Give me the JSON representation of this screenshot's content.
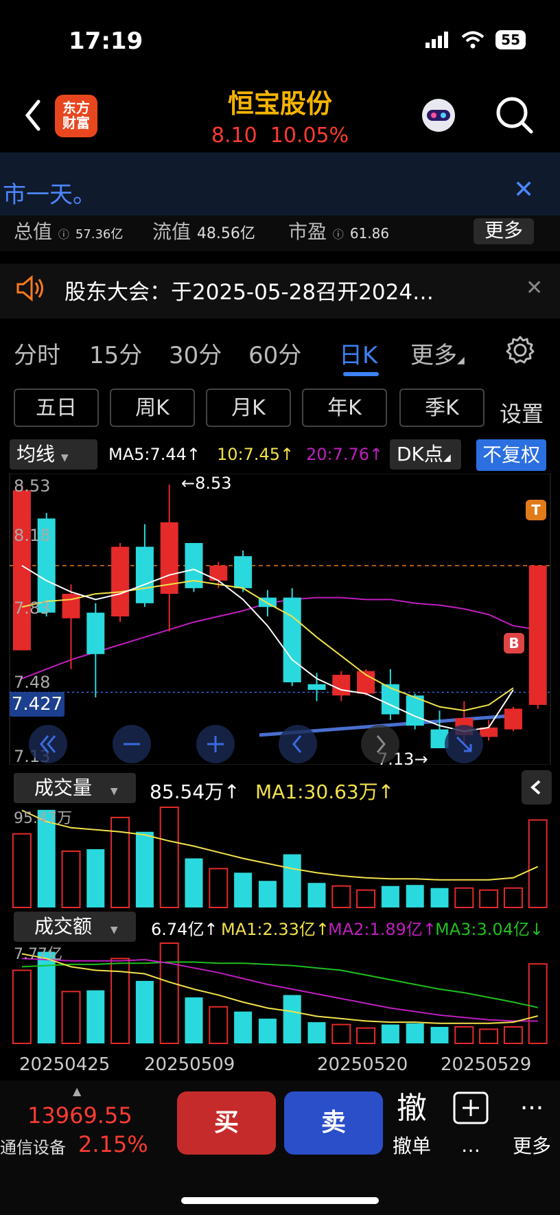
{
  "status": {
    "time": "17:19",
    "battery": "55"
  },
  "header": {
    "logo_line1": "东方",
    "logo_line2": "财富",
    "stock_name": "恒宝股份",
    "price": "8.10",
    "change_pct": "10.05%"
  },
  "banner": {
    "text": "市一天。"
  },
  "stats": {
    "total_label": "总值",
    "total_value": "57.36亿",
    "float_label": "流值",
    "float_value": "48.56亿",
    "pe_label": "市盈",
    "pe_value": "61.86",
    "more": "更多"
  },
  "notice": {
    "text": "股东大会：于2025-05-28召开2024…"
  },
  "period_tabs": [
    "分时",
    "15分",
    "30分",
    "60分",
    "日K",
    "更多"
  ],
  "k_buttons": [
    "五日",
    "周K",
    "月K",
    "年K",
    "季K"
  ],
  "settings_label": "设置",
  "ma_bar": {
    "selector": "均线",
    "ma5": "MA5:7.44↑",
    "ma10": "10:7.45↑",
    "ma20": "20:7.76↑",
    "dk": "DK点",
    "fq": "不复权"
  },
  "price_axis": {
    "labels": [
      "8.53",
      "8.18",
      "7.83",
      "7.48",
      "7.13"
    ],
    "current": "7.427",
    "high_marker": "←8.53",
    "low_marker": "7.13→"
  },
  "markers": {
    "t": "T",
    "b": "B"
  },
  "volume": {
    "selector": "成交量",
    "value": "85.54万↑",
    "ma1": "MA1:30.63万↑",
    "max_label": "95.47万"
  },
  "amount": {
    "selector": "成交额",
    "value": "6.74亿↑",
    "ma1": "MA1:2.33亿↑",
    "ma2": "MA2:1.89亿↑",
    "ma3": "MA3:3.04亿↓",
    "max_label": "7.77亿"
  },
  "dates": [
    "20250425",
    "20250509",
    "20250520",
    "20250529"
  ],
  "bottom": {
    "index_value": "13969.55",
    "index_name": "通信设备",
    "index_pct": "2.15%",
    "buy": "买",
    "sell": "卖",
    "cancel_glyph": "撤",
    "cancel_label": "撤单",
    "add_label": "…",
    "more_label": "更多"
  },
  "colors": {
    "up": "#e52a2a",
    "down": "#2ad9dd",
    "ma5": "#ffffff",
    "ma10": "#f2e24a",
    "ma20": "#c01ec0",
    "accent": "#3b82f6",
    "ma3": "#1ec01e"
  },
  "chart_data": {
    "type": "candlestick",
    "ylim": [
      7.13,
      8.53
    ],
    "candles": [
      {
        "open": 7.65,
        "close": 8.5,
        "high": 8.53,
        "low": 7.65
      },
      {
        "open": 8.35,
        "close": 7.85,
        "high": 8.38,
        "low": 7.83
      },
      {
        "open": 7.82,
        "close": 7.95,
        "high": 8.0,
        "low": 7.55
      },
      {
        "open": 7.85,
        "close": 7.63,
        "high": 7.9,
        "low": 7.4
      },
      {
        "open": 7.83,
        "close": 8.2,
        "high": 8.22,
        "low": 7.8
      },
      {
        "open": 8.2,
        "close": 7.9,
        "high": 8.32,
        "low": 7.88
      },
      {
        "open": 7.95,
        "close": 8.33,
        "high": 8.53,
        "low": 7.75
      },
      {
        "open": 8.22,
        "close": 7.98,
        "high": 8.22,
        "low": 7.96
      },
      {
        "open": 8.02,
        "close": 8.1,
        "high": 8.12,
        "low": 7.98
      },
      {
        "open": 8.15,
        "close": 7.98,
        "high": 8.18,
        "low": 7.96
      },
      {
        "open": 7.93,
        "close": 7.88,
        "high": 7.97,
        "low": 7.83
      },
      {
        "open": 7.93,
        "close": 7.48,
        "high": 7.98,
        "low": 7.46
      },
      {
        "open": 7.47,
        "close": 7.44,
        "high": 7.53,
        "low": 7.38
      },
      {
        "open": 7.41,
        "close": 7.52,
        "high": 7.54,
        "low": 7.38
      },
      {
        "open": 7.42,
        "close": 7.54,
        "high": 7.55,
        "low": 7.41
      },
      {
        "open": 7.47,
        "close": 7.31,
        "high": 7.55,
        "low": 7.28
      },
      {
        "open": 7.41,
        "close": 7.25,
        "high": 7.42,
        "low": 7.23
      },
      {
        "open": 7.23,
        "close": 7.13,
        "high": 7.33,
        "low": 7.13
      },
      {
        "open": 7.2,
        "close": 7.29,
        "high": 7.38,
        "low": 7.16
      },
      {
        "open": 7.19,
        "close": 7.24,
        "high": 7.28,
        "low": 7.17
      },
      {
        "open": 7.23,
        "close": 7.34,
        "high": 7.35,
        "low": 7.22
      },
      {
        "open": 7.36,
        "close": 8.1,
        "high": 8.1,
        "low": 7.34
      }
    ],
    "ma5": [
      8.1,
      8.02,
      7.96,
      7.92,
      7.95,
      8.0,
      8.05,
      8.08,
      8.02,
      7.92,
      7.78,
      7.6,
      7.5,
      7.44,
      7.42,
      7.36,
      7.3,
      7.25,
      7.22,
      7.24,
      7.44
    ],
    "ma10": [
      7.88,
      7.91,
      7.92,
      7.95,
      7.96,
      7.98,
      8.0,
      8.02,
      8.0,
      7.98,
      7.9,
      7.83,
      7.72,
      7.62,
      7.52,
      7.45,
      7.4,
      7.35,
      7.33,
      7.36,
      7.45
    ],
    "ma20": [
      7.5,
      7.55,
      7.6,
      7.64,
      7.68,
      7.72,
      7.76,
      7.8,
      7.83,
      7.86,
      7.9,
      7.92,
      7.93,
      7.93,
      7.92,
      7.92,
      7.9,
      7.89,
      7.87,
      7.84,
      7.78,
      7.76
    ],
    "volume": [
      72,
      95.47,
      55,
      57,
      88,
      74,
      98,
      48,
      38,
      34,
      26,
      52,
      24,
      21,
      17,
      21,
      22,
      19,
      19,
      17,
      19,
      85.54
    ],
    "volume_ma1": [
      95,
      84,
      78,
      76,
      74,
      71,
      65,
      60,
      54,
      48,
      43,
      38,
      34,
      31,
      29,
      28,
      28,
      27,
      27,
      27,
      29,
      40
    ],
    "amount": [
      6.2,
      7.77,
      4.4,
      4.5,
      7.2,
      5.3,
      8.5,
      3.9,
      3.1,
      2.7,
      2.1,
      4.1,
      1.8,
      1.6,
      1.3,
      1.6,
      1.7,
      1.4,
      1.4,
      1.2,
      1.4,
      6.74
    ],
    "amount_ma1": [
      7.6,
      7.2,
      6.5,
      6.2,
      6.1,
      5.9,
      5.2,
      4.6,
      4.1,
      3.5,
      3.0,
      2.7,
      2.3,
      2.1,
      1.9,
      1.8,
      1.8,
      1.7,
      1.7,
      1.7,
      1.8,
      2.33
    ],
    "amount_ma2": [
      7.2,
      7.1,
      7.0,
      7.0,
      7.0,
      7.1,
      6.8,
      6.4,
      6.0,
      5.5,
      5.0,
      4.6,
      4.2,
      3.8,
      3.4,
      3.0,
      2.7,
      2.4,
      2.2,
      2.0,
      1.9,
      1.89
    ],
    "amount_ma3": [
      6.5,
      6.6,
      6.7,
      6.7,
      6.8,
      6.8,
      6.9,
      6.9,
      6.8,
      6.8,
      6.7,
      6.6,
      6.4,
      6.2,
      5.8,
      5.4,
      5.0,
      4.6,
      4.3,
      3.9,
      3.5,
      3.04
    ]
  }
}
